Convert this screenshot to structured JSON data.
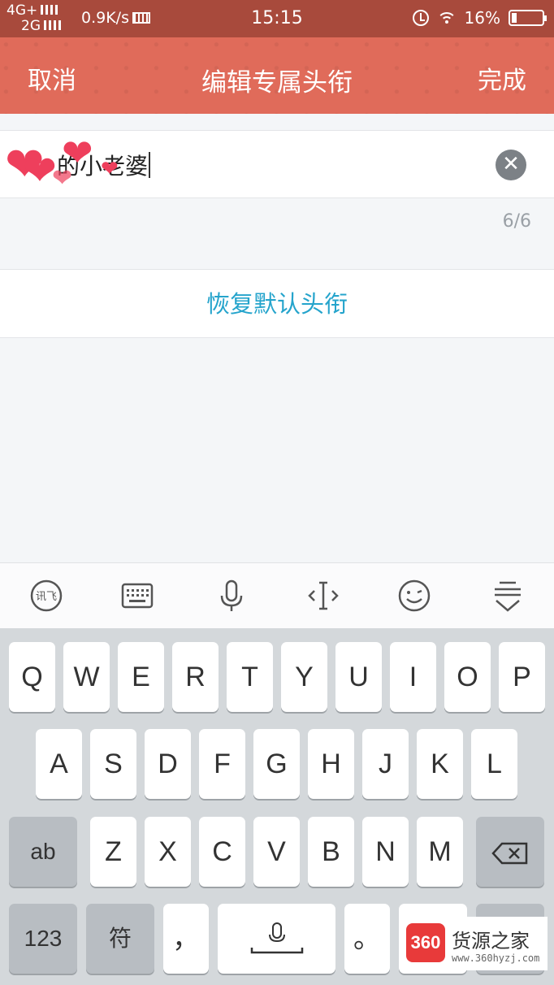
{
  "status_bar": {
    "network_top": "4G+",
    "network_bottom": "2G",
    "speed": "0.9K/s",
    "time": "15:15",
    "battery": "16%",
    "battery_level": 0.16
  },
  "nav": {
    "cancel_label": "取消",
    "title": "编辑专属头衔",
    "done_label": "完成"
  },
  "input": {
    "value": "的小老婆",
    "clear_icon": "clear-icon"
  },
  "counter": "6/6",
  "restore_label": "恢复默认头衔",
  "toolbar": {
    "icons": [
      "xunfei-icon",
      "keyboard-icon",
      "microphone-icon",
      "cursor-icon",
      "emoji-icon",
      "hide-keyboard-icon"
    ],
    "xunfei_text": "讯飞"
  },
  "keyboard": {
    "row1": [
      "Q",
      "W",
      "E",
      "R",
      "T",
      "Y",
      "U",
      "I",
      "O",
      "P"
    ],
    "row2": [
      "A",
      "S",
      "D",
      "F",
      "G",
      "H",
      "J",
      "K",
      "L"
    ],
    "row3": [
      "Z",
      "X",
      "C",
      "V",
      "B",
      "N",
      "M"
    ],
    "shift_label": "ab",
    "numbers_label": "123",
    "symbols_label": "符",
    "comma_label": "，",
    "period_label": "。"
  },
  "watermark": {
    "logo": "360",
    "name": "货源之家",
    "url": "www.360hyzj.com"
  },
  "colors": {
    "nav_bg": "#e06b5a",
    "status_bg": "#a84a3c",
    "link": "#25a4cc"
  }
}
